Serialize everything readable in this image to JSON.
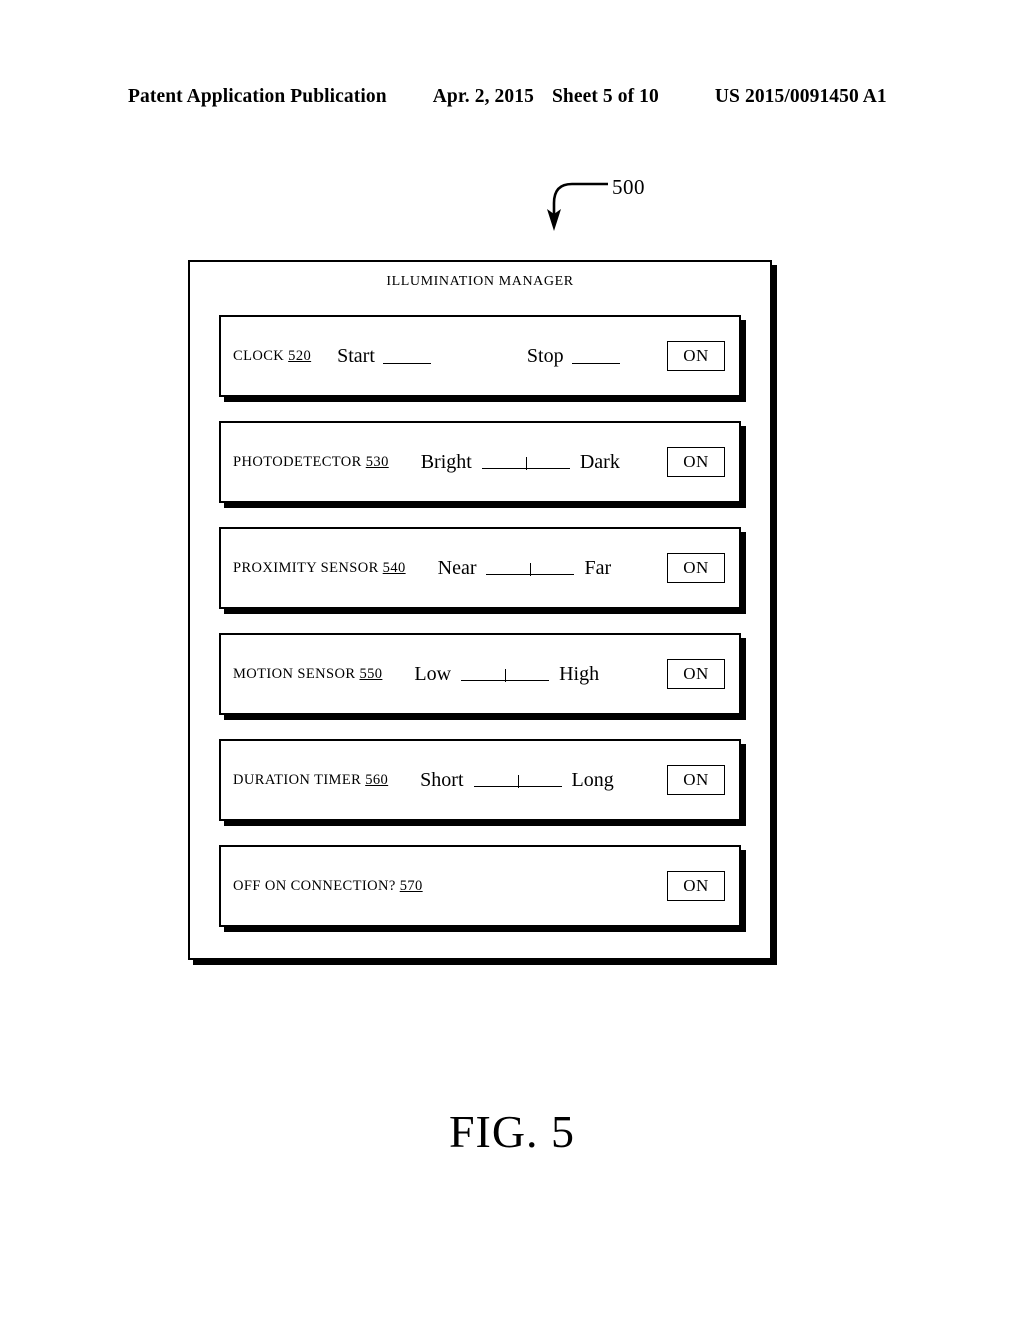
{
  "header": {
    "publication": "Patent Application Publication",
    "date": "Apr. 2, 2015",
    "sheet": "Sheet 5 of 10",
    "doc_number": "US 2015/0091450 A1"
  },
  "figure": {
    "reference_number": "500",
    "caption": "FIG. 5"
  },
  "panel": {
    "title": "ILLUMINATION MANAGER",
    "rows": [
      {
        "label": "CLOCK ",
        "refnum": "520",
        "control_type": "blanks",
        "fields": [
          {
            "label": "Start",
            "value": ""
          },
          {
            "label": "Stop",
            "value": ""
          }
        ],
        "button": "ON"
      },
      {
        "label": "PHOTODETECTOR ",
        "refnum": "530",
        "control_type": "slider",
        "min_label": "Bright",
        "max_label": "Dark",
        "thumb_position": "50%",
        "button": "ON"
      },
      {
        "label": "PROXIMITY SENSOR ",
        "refnum": "540",
        "control_type": "slider",
        "min_label": "Near",
        "max_label": "Far",
        "thumb_position": "50%",
        "button": "ON"
      },
      {
        "label": "MOTION SENSOR ",
        "refnum": "550",
        "control_type": "slider",
        "min_label": "Low",
        "max_label": "High",
        "thumb_position": "50%",
        "button": "ON"
      },
      {
        "label": "DURATION TIMER ",
        "refnum": "560",
        "control_type": "slider",
        "min_label": "Short",
        "max_label": "Long",
        "thumb_position": "50%",
        "button": "ON"
      },
      {
        "label": "OFF ON CONNECTION? ",
        "refnum": "570",
        "control_type": "none",
        "button": "ON"
      }
    ]
  }
}
